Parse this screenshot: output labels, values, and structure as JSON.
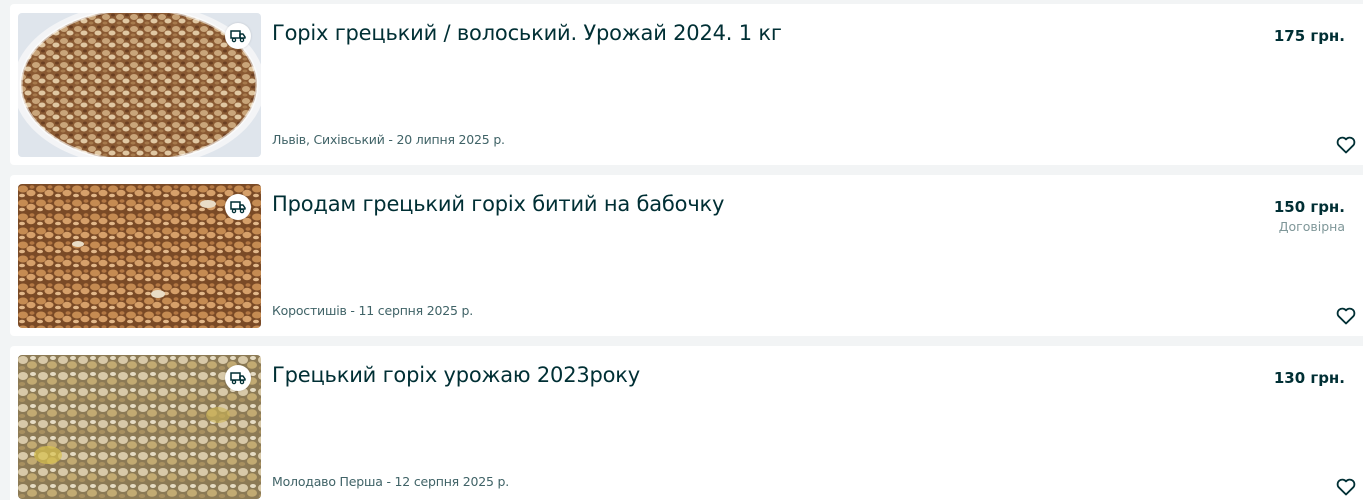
{
  "listings": [
    {
      "title": "Горіх грецький / волоський. Урожай 2024. 1 кг",
      "location_date": "Львів, Сихівський - 20 липня 2025 р.",
      "price": "175 грн.",
      "negotiable": "",
      "delivery_icon": "truck-icon",
      "favorite_icon": "heart-outline-icon",
      "image": "walnut-kernels-in-glass-bowl"
    },
    {
      "title": "Продам грецький горіх битий на бабочку",
      "location_date": "Коростишів - 11 серпня 2025 р.",
      "price": "150 грн.",
      "negotiable": "Договірна",
      "delivery_icon": "truck-icon",
      "favorite_icon": "heart-outline-icon",
      "image": "walnut-halves-butterfly"
    },
    {
      "title": "Грецький горіх урожаю 2023року",
      "location_date": "Молодаво Перша - 12 серпня 2025 р.",
      "price": "130 грн.",
      "negotiable": "",
      "delivery_icon": "truck-icon",
      "favorite_icon": "heart-outline-icon",
      "image": "walnut-kernels-pile"
    }
  ],
  "colors": {
    "page_background": "#f2f4f5",
    "card_background": "#ffffff",
    "title_text": "#002f34",
    "meta_text": "#406367",
    "negotiable_text": "#7f9799"
  }
}
